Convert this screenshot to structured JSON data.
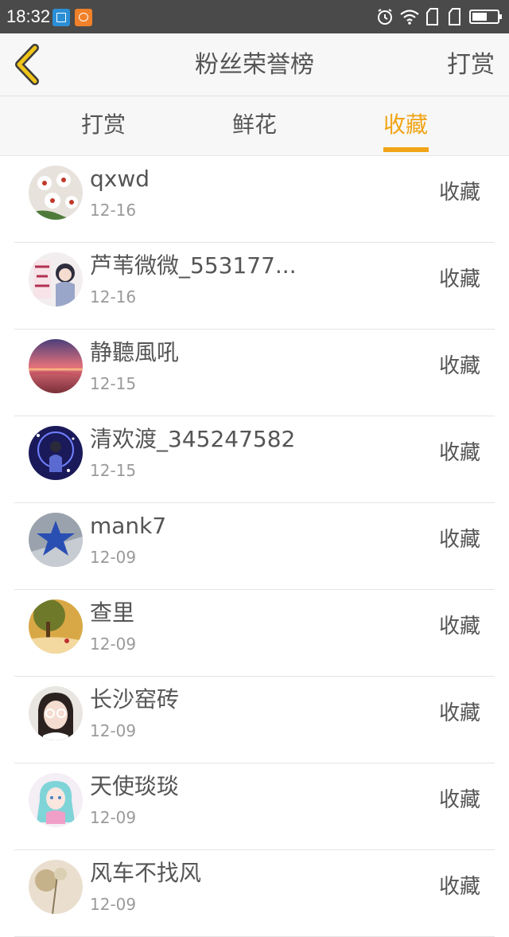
{
  "status_bar": {
    "time": "18:32"
  },
  "header": {
    "title": "粉丝荣誉榜",
    "right_link": "打赏"
  },
  "accent_color": "#f0a416",
  "tabs": [
    {
      "label": "打赏",
      "active": false
    },
    {
      "label": "鲜花",
      "active": false
    },
    {
      "label": "收藏",
      "active": true
    }
  ],
  "list": [
    {
      "name": "qxwd",
      "date": "12-16",
      "action": "收藏"
    },
    {
      "name": "芦苇微微_553177...",
      "date": "12-16",
      "action": "收藏"
    },
    {
      "name": "静聽風吼",
      "date": "12-15",
      "action": "收藏"
    },
    {
      "name": "清欢渡_345247582",
      "date": "12-15",
      "action": "收藏"
    },
    {
      "name": "mank7",
      "date": "12-09",
      "action": "收藏"
    },
    {
      "name": "查里",
      "date": "12-09",
      "action": "收藏"
    },
    {
      "name": "长沙窑砖",
      "date": "12-09",
      "action": "收藏"
    },
    {
      "name": "天使琰琰",
      "date": "12-09",
      "action": "收藏"
    },
    {
      "name": "风车不找风",
      "date": "12-09",
      "action": "收藏"
    }
  ]
}
